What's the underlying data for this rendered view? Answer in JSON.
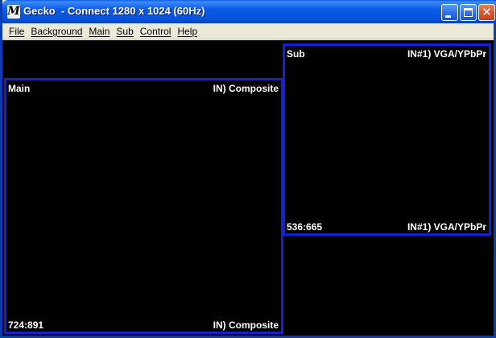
{
  "window": {
    "icon_letter": "M",
    "title": "Gecko  - Connect 1280 x 1024 (60Hz)",
    "colors": {
      "titlebar": "#0a5ae8",
      "panel_border": "#1221d6",
      "background": "#000000"
    }
  },
  "caption_buttons": {
    "minimize": "minimize-icon",
    "maximize": "maximize-icon",
    "close": "close-icon"
  },
  "menu": {
    "items": [
      "File",
      "Background",
      "Main",
      "Sub",
      "Control",
      "Help"
    ]
  },
  "panels": {
    "main": {
      "name": "Main",
      "input_top": "IN) Composite",
      "resolution": "724:891",
      "input_bottom": "IN) Composite"
    },
    "sub": {
      "name": "Sub",
      "input_top": "IN#1) VGA/YPbPr",
      "resolution": "536:665",
      "input_bottom": "IN#1) VGA/YPbPr"
    }
  }
}
